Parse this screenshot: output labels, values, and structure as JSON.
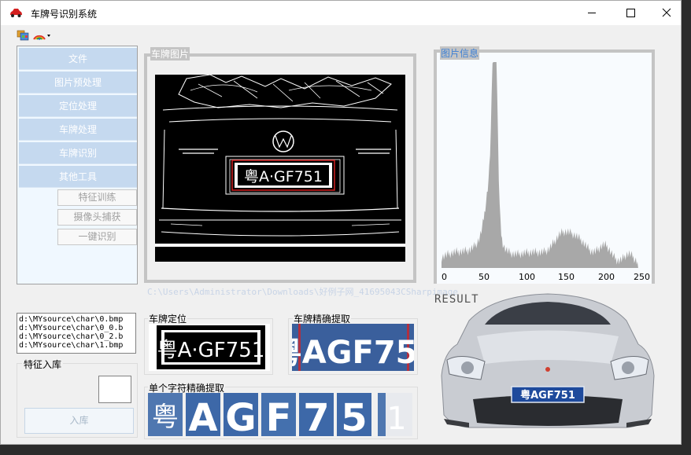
{
  "window": {
    "title": "车牌号识别系统",
    "minimize_label": "—",
    "maximize_label": "☐",
    "close_label": "✕"
  },
  "toolbar": {
    "icons": [
      "image-folder-icon",
      "color-palette-icon"
    ]
  },
  "sidebar": {
    "items": [
      {
        "label": "文件"
      },
      {
        "label": "图片预处理"
      },
      {
        "label": "定位处理"
      },
      {
        "label": "车牌处理"
      },
      {
        "label": "车牌识别"
      },
      {
        "label": "其他工具"
      }
    ],
    "subitems": [
      {
        "label": "特征训练"
      },
      {
        "label": "摄像头捕获"
      },
      {
        "label": "一键识别"
      }
    ]
  },
  "panels": {
    "plate_image_title": "车牌图片",
    "image_info_title": "图片信息",
    "file_path": "C:\\Users\\Administrator\\Downloads\\好例子网_41695043CSharpimage"
  },
  "histogram": {
    "ticks": [
      "0",
      "50",
      "100",
      "150",
      "200",
      "250"
    ]
  },
  "features_list": {
    "items": [
      "d:\\MYsource\\char\\0.bmp",
      "d:\\MYsource\\char\\0_0.b",
      "d:\\MYsource\\char\\0_2.b",
      "d:\\MYsource\\char\\1.bmp"
    ]
  },
  "feature_storage": {
    "legend": "特征入库",
    "button_label": "入库"
  },
  "captions": {
    "plate_location": "车牌定位",
    "plate_precise": "车牌精确提取",
    "char_precise": "单个字符精确提取",
    "result": "RESULT"
  },
  "plate": {
    "text_binary": "粤A·GF751",
    "text_car": "粤AGF751",
    "chars": [
      "粤",
      "A",
      "G",
      "F",
      "7",
      "5",
      "1"
    ]
  },
  "colors": {
    "sidebar_button": "#c5d9ef",
    "group_title": "#3c7fd4",
    "plate_blue": "#2a5ca8"
  }
}
